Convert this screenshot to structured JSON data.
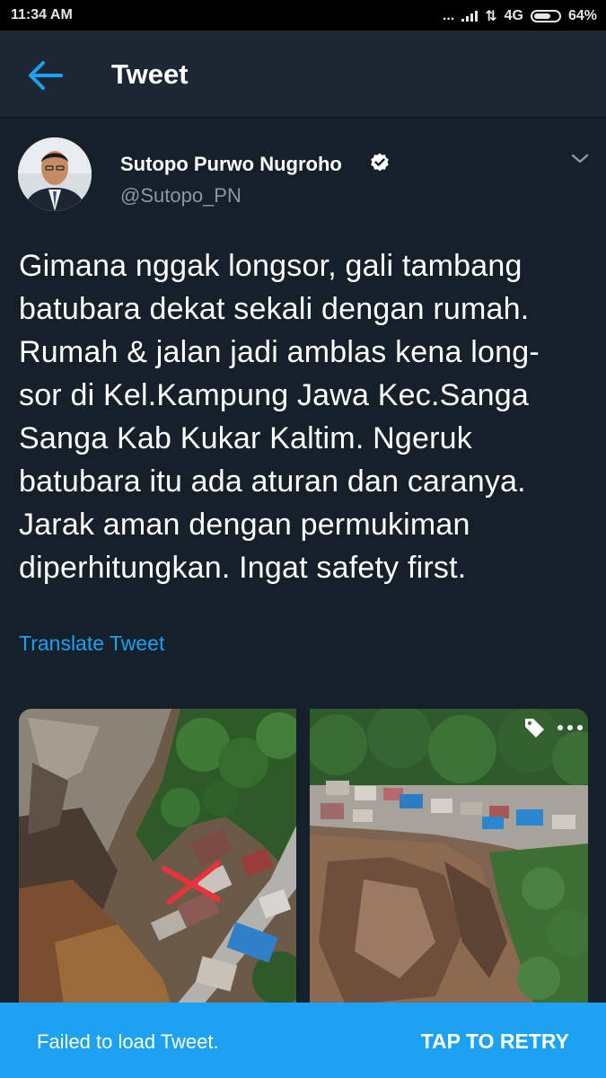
{
  "status_bar": {
    "time": "11:34 AM",
    "dots": "...",
    "network": "4G",
    "battery": "64%"
  },
  "header": {
    "back_icon": "arrow-left-icon",
    "title": "Tweet"
  },
  "tweet": {
    "author_name": "Sutopo Purwo Nugroho",
    "verified_icon": "verified-badge-icon",
    "handle": "@Sutopo_PN",
    "caret_icon": "chevron-down-icon",
    "text_lines": [
      "Gimana nggak longsor, gali tambang",
      "batubara dekat sekali dengan rumah.",
      "Rumah & jalan jadi amblas kena long-",
      "sor di Kel.Kampung Jawa Kec.Sanga",
      "Sanga Kab Kukar Kaltim. Ngeruk",
      "batubara itu ada aturan dan caranya.",
      "Jarak aman dengan permukiman",
      "diperhitungkan. Ingat safety first."
    ],
    "translate_label": "Translate Tweet"
  },
  "media": {
    "tag_icon": "tag-icon",
    "more_icon": "more-horizontal-icon"
  },
  "snackbar": {
    "message": "Failed to load Tweet.",
    "action": "TAP TO RETRY"
  },
  "colors": {
    "background": "#15202b",
    "header": "#1c2733",
    "accent": "#1da1f2",
    "secondary_text": "#8899a6"
  }
}
